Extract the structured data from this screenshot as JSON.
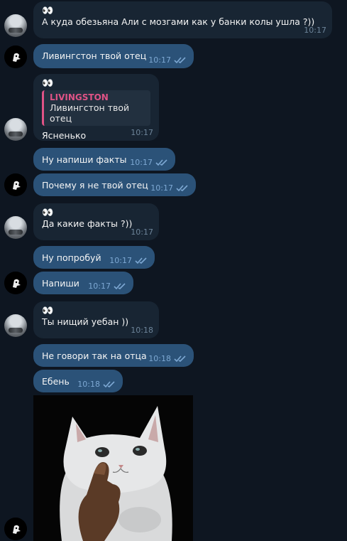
{
  "messages": [
    {
      "sender": "in",
      "name": "👀",
      "text": "А куда обезьяна Али с мозгами как у банки колы ушла ?))",
      "time": "10:17"
    },
    {
      "sender": "out",
      "text": "Ливингстон твой отец",
      "time": "10:17"
    },
    {
      "sender": "in",
      "name": "👀",
      "reply_name": "LIVINGSTON",
      "reply_text": "Ливингстон твой отец",
      "text": "Ясненько",
      "time": "10:17"
    },
    {
      "sender": "out",
      "text": "Ну напиши факты",
      "time": "10:17"
    },
    {
      "sender": "out",
      "text": "Почему я не твой отец",
      "time": "10:17"
    },
    {
      "sender": "in",
      "name": "👀",
      "text": "Да какие факты ?))",
      "time": "10:17"
    },
    {
      "sender": "out",
      "text": "Ну попробуй",
      "time": "10:17"
    },
    {
      "sender": "out",
      "text": "Напиши",
      "time": "10:17"
    },
    {
      "sender": "in",
      "name": "👀",
      "text": "Ты нищий уебан ))",
      "time": "10:18"
    },
    {
      "sender": "out",
      "text": "Не говори так на отца",
      "time": "10:18"
    },
    {
      "sender": "out",
      "text": "Ебень",
      "time": "10:18"
    }
  ],
  "colors": {
    "background": "#0e1621",
    "incoming": "#182533",
    "outgoing": "#2b5278",
    "accent": "#e05386"
  },
  "icons": {
    "read": "double-check-icon"
  }
}
